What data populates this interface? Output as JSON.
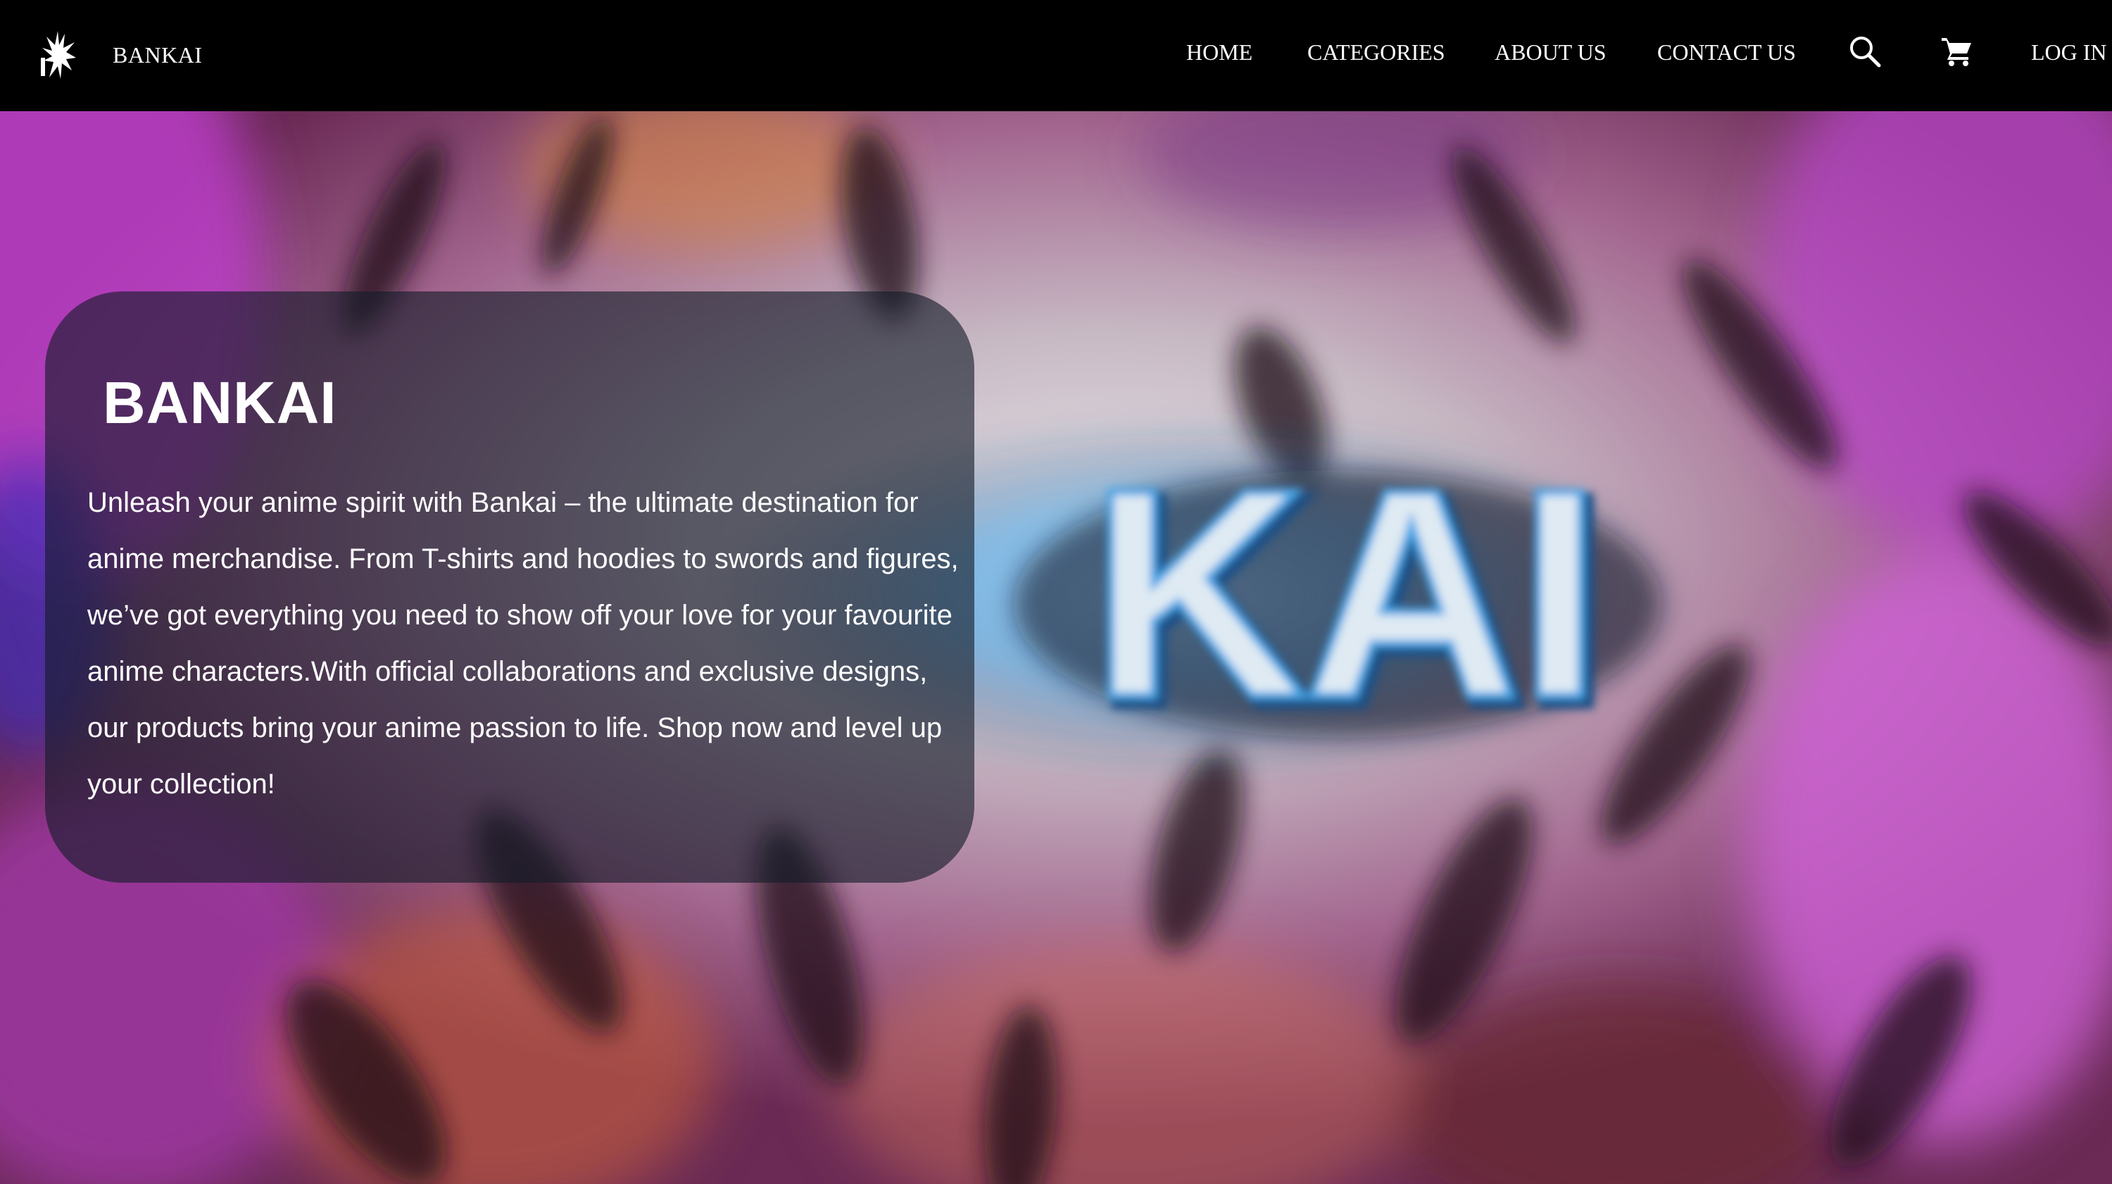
{
  "brand": {
    "logo_icon": "bleach-logo-icon",
    "name": "BANKAI"
  },
  "nav": {
    "items": [
      {
        "label": "HOME"
      },
      {
        "label": "CATEGORIES"
      },
      {
        "label": "ABOUT US"
      },
      {
        "label": "CONTACT US"
      }
    ],
    "search_icon": "search-icon",
    "cart_icon": "cart-icon",
    "login_label": "LOG IN"
  },
  "hero": {
    "background_text": "BANKAI",
    "card": {
      "title": "BANKAI",
      "description": "Unleash your anime spirit with Bankai – the ultimate destination for anime merchandise. From T-shirts and hoodies to swords and figures, we’ve got everything you need to show off your love for your favourite anime characters.With official collaborations and exclusive designs, our products bring your anime passion to life. Shop now and level up your collection!"
    }
  },
  "colors": {
    "navbar_bg": "#000000",
    "text": "#ffffff",
    "glow_blue": "#3aa0e6",
    "magenta": "#c040c8"
  }
}
